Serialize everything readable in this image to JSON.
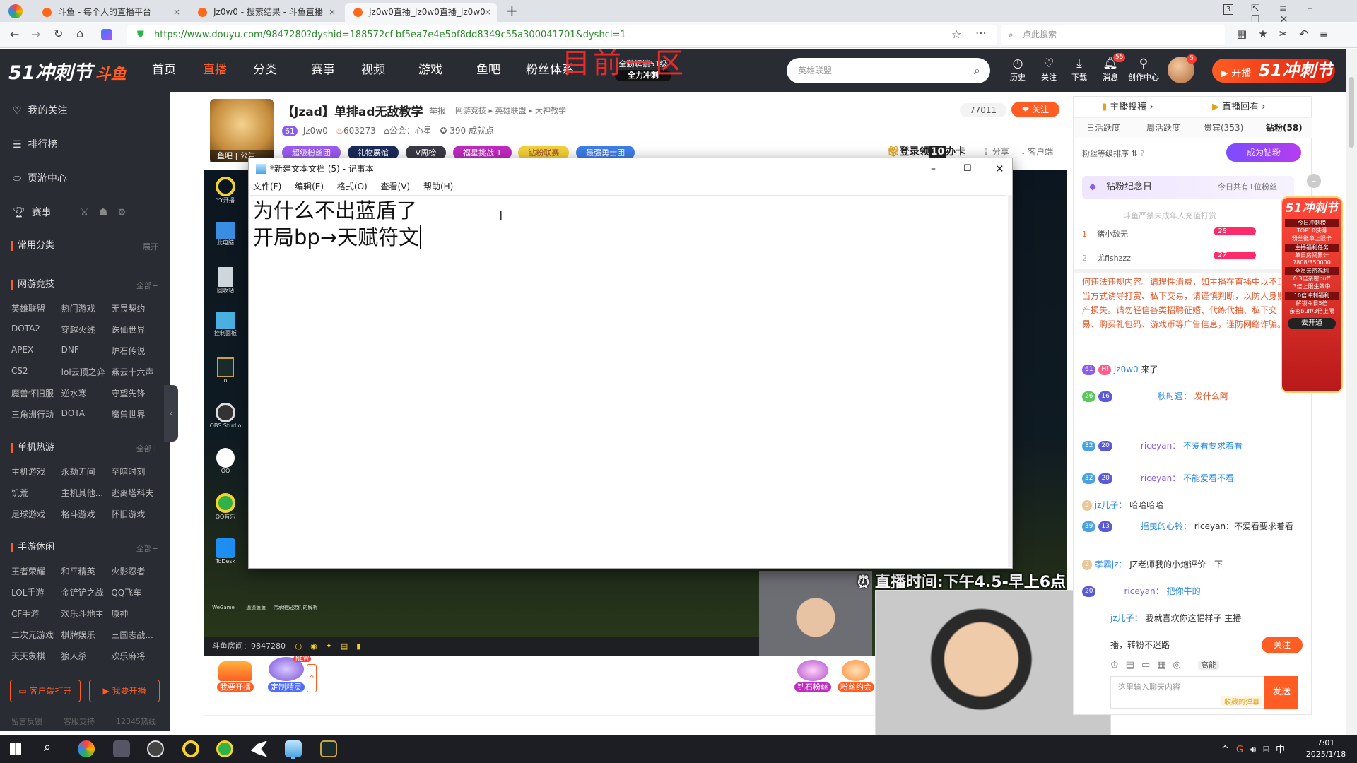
{
  "browser": {
    "tabs": [
      {
        "label": "斗鱼 - 每个人的直播平台"
      },
      {
        "label": "Jz0w0 - 搜索结果 - 斗鱼直播"
      },
      {
        "label": "Jz0w0直播_Jz0w0直播_Jz0w0"
      }
    ],
    "tab_close": "×",
    "new_tab": "+",
    "url": "https://www.douyu.com/9847280?dyshid=188572cf-bf5ea7e4e5bf8dd8349c55a300041701&dyshci=1",
    "search_placeholder": "点此搜索",
    "tab_count": "3"
  },
  "header": {
    "logo": "51冲刺节",
    "logo_brand": "斗鱼",
    "nav": [
      "首页",
      "直播",
      "分类",
      "赛事",
      "视频",
      "游戏",
      "鱼吧",
      "粉丝体系"
    ],
    "promo_top": "全勤解锁51级",
    "promo_bottom": "全力冲刺",
    "search_placeholder": "英雄联盟",
    "icons": [
      {
        "label": "历史",
        "icon": "clock-icon"
      },
      {
        "label": "关注",
        "icon": "heart-icon"
      },
      {
        "label": "下载",
        "icon": "download-icon"
      },
      {
        "label": "消息",
        "icon": "bell-icon"
      },
      {
        "label": "创作中心",
        "icon": "pin-icon"
      }
    ],
    "msg_badge": "55",
    "avatar_badge": "5",
    "start_live": "开播",
    "right_banner": "51冲刺节",
    "overlay_text": "目前一区"
  },
  "sidebar": {
    "main": [
      "我的关注",
      "排行榜",
      "页游中心",
      "赛事"
    ],
    "common": {
      "title": "常用分类",
      "more": "展开"
    },
    "groups": [
      {
        "title": "网游竞技",
        "more": "全部+",
        "items": [
          "英雄联盟",
          "热门游戏",
          "无畏契约",
          "DOTA2",
          "穿越火线",
          "诛仙世界",
          "APEX",
          "DNF",
          "炉石传说",
          "CS2",
          "lol云顶之弈",
          "燕云十六声",
          "魔兽怀旧服",
          "逆水寒",
          "守望先锋",
          "三角洲行动",
          "DOTA",
          "魔兽世界"
        ]
      },
      {
        "title": "单机热游",
        "more": "全部+",
        "items": [
          "主机游戏",
          "永劫无间",
          "至暗时刻",
          "饥荒",
          "主机其他...",
          "逃离塔科夫",
          "足球游戏",
          "格斗游戏",
          "怀旧游戏"
        ]
      },
      {
        "title": "手游休闲",
        "more": "全部+",
        "items": [
          "王者荣耀",
          "和平精英",
          "火影忍者",
          "LOL手游",
          "金铲铲之战",
          "QQ飞车",
          "CF手游",
          "欢乐斗地主",
          "原神",
          "二次元游戏",
          "棋牌娱乐",
          "三国志战...",
          "天天象棋",
          "狼人杀",
          "欢乐麻将"
        ]
      }
    ],
    "btn_client": "客户端打开",
    "btn_live": "我要开播",
    "footer": [
      "留言反馈",
      "客服支持",
      "12345热线"
    ]
  },
  "streamer": {
    "title": "【Jzad】单排ad无敌教学",
    "report": "举报",
    "crumbs": [
      "网游竞技",
      "英雄联盟",
      "大神教学"
    ],
    "level": "61",
    "name": "Jz0w0",
    "hot": "603273",
    "guild": "公会：心星",
    "achievement": "390 成就点",
    "viewers": "77011",
    "follow": "关注",
    "fan_label": "鱼吧",
    "notice": "公告",
    "pills": [
      "超级粉丝团",
      "礼物展馆",
      "V周榜",
      "福星挑战 1",
      "钻粉联赛",
      "最强勇士团"
    ],
    "gift_promo": "登录领",
    "gift_promo_num": "10",
    "gift_promo_end": "办卡",
    "share": "分享",
    "client": "客户端"
  },
  "player": {
    "desktop_icons": [
      "YY开播",
      "此电脑",
      "回收站",
      "控制面板",
      "lol",
      "OBS Studio",
      "QQ",
      "QQ音乐",
      "ToDesk"
    ],
    "bottom_icons": [
      "WeGame",
      "逍遥鱼鱼",
      "伟承他兄弟们的解析"
    ],
    "room_label": "斗鱼房间：9847280",
    "schedule": "直播时间:下午4.5-早上6点",
    "btn_start": "我要开播",
    "btn_sprite": "定制精灵",
    "new_tag": "NEW",
    "diamond": "钻石粉丝",
    "fan_meet": "粉丝约会"
  },
  "notepad": {
    "title": "*新建文本文档 (5) - 记事本",
    "menus": [
      "文件(F)",
      "编辑(E)",
      "格式(O)",
      "查看(V)",
      "帮助(H)"
    ],
    "lines": [
      "为什么不出蓝盾了",
      "开局bp→天赋符文"
    ]
  },
  "chat": {
    "tabs_top": [
      "主播投稿",
      "直播回看"
    ],
    "tabs": [
      "日活跃度",
      "周活跃度",
      "贵宾(353)",
      "钻粉(58)"
    ],
    "sort_label": "粉丝等级排序",
    "become_diamond": "成为钻粉",
    "anniversary": "钻粉纪念日",
    "anniversary_sub": "今日共有1位粉丝",
    "notice": "斗鱼严禁未成年人充值打赏",
    "rank": [
      {
        "n": "1",
        "name": "猪小敌无",
        "lv": "28"
      },
      {
        "n": "2",
        "name": "尤fishzzz",
        "lv": "27"
      }
    ],
    "warning": "何违法违规内容。请理性消费，如主播在直播中以不正当方式诱导打赏、私下交易，请谨慎判断，以防人身财产损失。请勿轻信各类招聘征婚、代练代抽、私下交易、购买礼包码、游戏币等广告信息，谨防网络诈骗。",
    "messages": [
      {
        "badges": [
          "61",
          "Hi"
        ],
        "user": "Jz0w0",
        "text": "来了"
      },
      {
        "badges": [
          "26",
          "16"
        ],
        "user": "秋时遇：",
        "text": "发什么阿"
      },
      {
        "badges": [
          "32",
          "20"
        ],
        "user": "riceyan：",
        "text": "不爱看要求着看"
      },
      {
        "badges": [
          "32",
          "20"
        ],
        "user": "riceyan：",
        "text": "不能爱看不看"
      },
      {
        "badges": [
          "3"
        ],
        "user": "jz儿子：",
        "text": "哈哈哈哈"
      },
      {
        "badges": [
          "39",
          "13"
        ],
        "user": "摇曳的心铃：",
        "text": "riceyan：不爱看要求着看"
      },
      {
        "badges": [
          "2"
        ],
        "user": "孝霸jz：",
        "text": "JZ老师我的小炮评价一下"
      },
      {
        "badges": [
          "20"
        ],
        "user": "riceyan：",
        "text": "把你牛的"
      },
      {
        "badges": [],
        "user": "jz儿子：",
        "text": "我就喜欢你这幅样子 主播"
      },
      {
        "badges": [],
        "user": "",
        "text": "播，转粉不迷路"
      }
    ],
    "follow": "关注",
    "input_placeholder": "这里输入聊天内容",
    "send": "发送",
    "barrage": "收藏的弹幕",
    "tool_hd": "高能"
  },
  "side_promo": {
    "title": "51冲刺节",
    "lines": [
      "今日冲刺榜",
      "TOP10获得",
      "粉丝徽章上限卡",
      "主播福利任务",
      "单日房间累计",
      "7808/350000",
      "全员亲密福利",
      "0.3倍亲密buff",
      "3倍上限生效中",
      "10倍冲刺福利",
      "解锁今日5倍",
      "亲密buff/3倍上限",
      "去开通"
    ]
  },
  "taskbar": {
    "time": "7:01",
    "date": "2025/1/18",
    "ime": "中"
  },
  "colors": {
    "accent": "#ff5d23",
    "dark": "#2a2c33",
    "link": "#2e8be6"
  }
}
